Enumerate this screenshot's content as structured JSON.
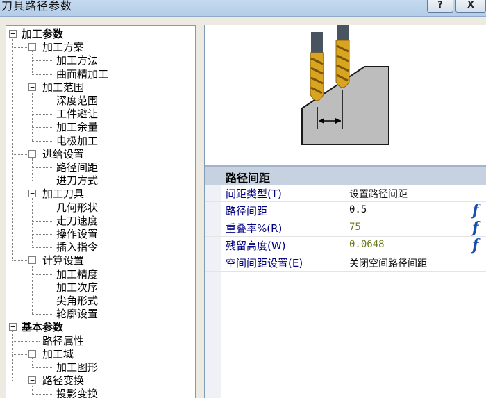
{
  "window": {
    "title": "刀具路径参数",
    "help_label": "?",
    "close_label": "X"
  },
  "tree": {
    "sections": [
      {
        "label": "加工参数",
        "children": [
          {
            "label": "加工方案",
            "children": [
              "加工方法",
              "曲面精加工"
            ]
          },
          {
            "label": "加工范围",
            "children": [
              "深度范围",
              "工件避让",
              "加工余量",
              "电极加工"
            ]
          },
          {
            "label": "进给设置",
            "children": [
              "路径间距",
              "进刀方式"
            ]
          },
          {
            "label": "加工刀具",
            "children": [
              "几何形状",
              "走刀速度",
              "操作设置",
              "插入指令"
            ]
          },
          {
            "label": "计算设置",
            "children": [
              "加工精度",
              "加工次序",
              "尖角形式",
              "轮廓设置"
            ]
          }
        ]
      },
      {
        "label": "基本参数",
        "children": [
          {
            "label": "路径属性"
          },
          {
            "label": "加工域",
            "children": [
              "加工图形"
            ]
          },
          {
            "label": "路径变换",
            "children": [
              "投影变换"
            ]
          }
        ]
      }
    ]
  },
  "property_grid": {
    "section_title": "路径间距",
    "rows": [
      {
        "label": "间距类型(T)",
        "value": "设置路径间距",
        "fx": ""
      },
      {
        "label": "路径间距",
        "value": "0.5",
        "fx": "f"
      },
      {
        "label": "重叠率%(R)",
        "value": "75",
        "fx": "f"
      },
      {
        "label": "残留高度(W)",
        "value": "0.0648",
        "fx": "f"
      },
      {
        "label": "空间间距设置(E)",
        "value": "关闭空间路径间距",
        "fx": ""
      }
    ]
  },
  "colors": {
    "accent": "#1a4fb0",
    "tool_gold": "#d9a520",
    "tool_shank": "#4a5360",
    "workpiece": "#bdbdbd"
  }
}
